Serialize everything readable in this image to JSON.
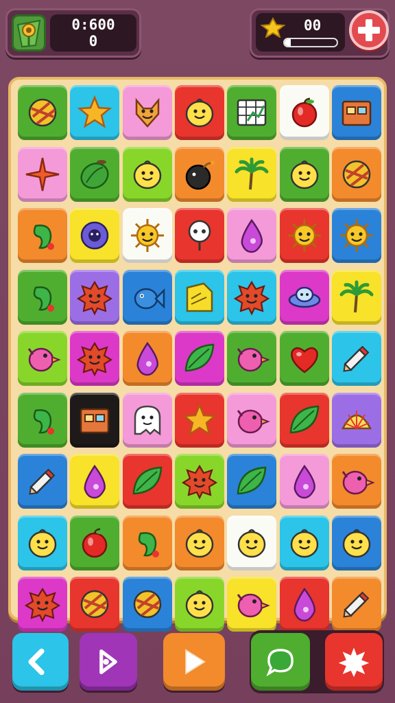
{
  "hud": {
    "avatar_icon": "sunflower-flag-icon",
    "timer": "0:600",
    "score": "0",
    "coins": "00",
    "coin_icon": "gold-star-gem-icon",
    "coin_progress": 0.12,
    "add_icon": "plus-icon"
  },
  "colors": {
    "green": "#4fae2f",
    "cyan": "#2cc4e8",
    "pink": "#f49ad8",
    "red": "#e8352d",
    "white": "#fbfbf6",
    "blue": "#2a83d8",
    "lime": "#89d62b",
    "orange": "#f38a2c",
    "yellow": "#f8e22a",
    "purple": "#9c6ee6",
    "magenta": "#dc39c8",
    "black": "#1e1a1a",
    "board_bg": "#f6dca6",
    "page_bg": "#7a4560"
  },
  "board": {
    "rows": [
      [
        {
          "color": "green",
          "icon": "striped-ball-icon"
        },
        {
          "color": "cyan",
          "icon": "star-icon"
        },
        {
          "color": "pink",
          "icon": "fox-face-icon"
        },
        {
          "color": "red",
          "icon": "smiling-blob-icon"
        },
        {
          "color": "green",
          "icon": "grid-chart-icon"
        },
        {
          "color": "white",
          "icon": "apple-icon"
        },
        {
          "color": "blue",
          "icon": "box-icon"
        }
      ],
      [
        {
          "color": "pink",
          "icon": "sparkle-star-icon"
        },
        {
          "color": "green",
          "icon": "watermelon-icon"
        },
        {
          "color": "lime",
          "icon": "smiling-blob-icon"
        },
        {
          "color": "orange",
          "icon": "bomb-icon"
        },
        {
          "color": "yellow",
          "icon": "palm-tree-icon"
        },
        {
          "color": "green",
          "icon": "smiling-blob-icon"
        },
        {
          "color": "orange",
          "icon": "striped-ball-icon"
        }
      ],
      [
        {
          "color": "orange",
          "icon": "pepper-icon"
        },
        {
          "color": "yellow",
          "icon": "flower-icon"
        },
        {
          "color": "white",
          "icon": "sun-icon"
        },
        {
          "color": "red",
          "icon": "skull-icon"
        },
        {
          "color": "pink",
          "icon": "drop-icon"
        },
        {
          "color": "red",
          "icon": "sun-icon"
        },
        {
          "color": "blue",
          "icon": "sun-icon"
        }
      ],
      [
        {
          "color": "green",
          "icon": "pepper-icon"
        },
        {
          "color": "purple",
          "icon": "spiky-blob-icon"
        },
        {
          "color": "blue",
          "icon": "fish-icon"
        },
        {
          "color": "cyan",
          "icon": "note-icon"
        },
        {
          "color": "cyan",
          "icon": "spiky-blob-icon"
        },
        {
          "color": "magenta",
          "icon": "ufo-icon"
        },
        {
          "color": "yellow",
          "icon": "palm-tree-icon"
        }
      ],
      [
        {
          "color": "lime",
          "icon": "bird-icon"
        },
        {
          "color": "magenta",
          "icon": "spiky-blob-icon"
        },
        {
          "color": "orange",
          "icon": "drop-icon"
        },
        {
          "color": "magenta",
          "icon": "leaf-icon"
        },
        {
          "color": "green",
          "icon": "bird-icon"
        },
        {
          "color": "green",
          "icon": "heart-icon"
        },
        {
          "color": "cyan",
          "icon": "pencil-icon"
        }
      ],
      [
        {
          "color": "green",
          "icon": "pepper-icon"
        },
        {
          "color": "black",
          "icon": "box-icon"
        },
        {
          "color": "pink",
          "icon": "ghost-icon"
        },
        {
          "color": "red",
          "icon": "star-icon"
        },
        {
          "color": "pink",
          "icon": "bird-icon"
        },
        {
          "color": "red",
          "icon": "leaf-icon"
        },
        {
          "color": "purple",
          "icon": "shell-icon"
        }
      ],
      [
        {
          "color": "blue",
          "icon": "pencil-icon"
        },
        {
          "color": "yellow",
          "icon": "drop-icon"
        },
        {
          "color": "red",
          "icon": "leaf-icon"
        },
        {
          "color": "lime",
          "icon": "spiky-blob-icon"
        },
        {
          "color": "blue",
          "icon": "leaf-icon"
        },
        {
          "color": "pink",
          "icon": "drop-icon"
        },
        {
          "color": "orange",
          "icon": "bird-icon"
        }
      ],
      [
        {
          "color": "cyan",
          "icon": "smiling-blob-icon"
        },
        {
          "color": "green",
          "icon": "apple-icon"
        },
        {
          "color": "orange",
          "icon": "pepper-icon"
        },
        {
          "color": "orange",
          "icon": "smiling-blob-icon"
        },
        {
          "color": "white",
          "icon": "smiling-blob-icon"
        },
        {
          "color": "cyan",
          "icon": "smiling-blob-icon"
        },
        {
          "color": "blue",
          "icon": "smiling-blob-icon"
        }
      ],
      [
        {
          "color": "magenta",
          "icon": "spiky-blob-icon"
        },
        {
          "color": "red",
          "icon": "striped-ball-icon"
        },
        {
          "color": "blue",
          "icon": "striped-ball-icon"
        },
        {
          "color": "lime",
          "icon": "smiling-blob-icon"
        },
        {
          "color": "yellow",
          "icon": "bird-icon"
        },
        {
          "color": "red",
          "icon": "drop-icon"
        },
        {
          "color": "orange",
          "icon": "pencil-icon"
        }
      ]
    ]
  },
  "controls": [
    {
      "name": "back-button",
      "icon": "back-arrow-icon",
      "color": "#2cc4e8"
    },
    {
      "name": "share-button",
      "icon": "share-arrow-icon",
      "color": "#a035b8"
    },
    {
      "name": "play-button",
      "icon": "play-icon",
      "color": "#f38a2c"
    },
    {
      "name": "chat-button",
      "icon": "chat-bubble-icon",
      "color": "#4fae2f"
    },
    {
      "name": "burst-button",
      "icon": "burst-icon",
      "color": "#e8352d"
    }
  ]
}
